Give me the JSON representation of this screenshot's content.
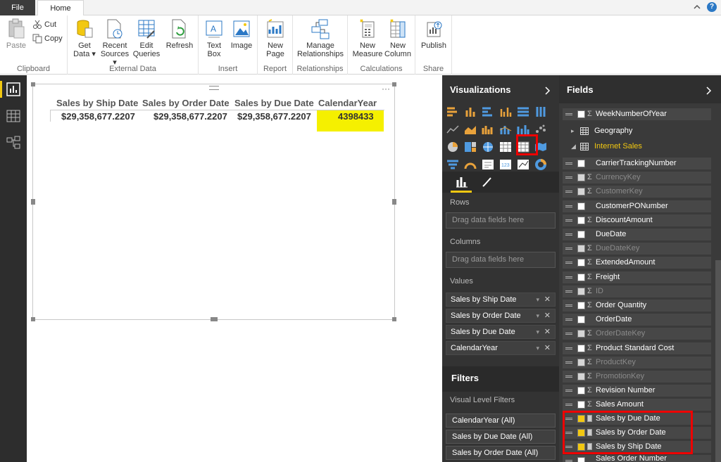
{
  "tabs": {
    "file": "File",
    "home": "Home"
  },
  "ribbon": {
    "clipboard": {
      "label": "Clipboard",
      "paste": "Paste",
      "cut": "Cut",
      "copy": "Copy"
    },
    "external_data": {
      "label": "External Data",
      "get_data": [
        "Get",
        "Data ▾"
      ],
      "recent_sources": [
        "Recent",
        "Sources ▾"
      ],
      "edit_queries": [
        "Edit",
        "Queries"
      ],
      "refresh": "Refresh"
    },
    "insert": {
      "label": "Insert",
      "text_box": [
        "Text",
        "Box"
      ],
      "image": "Image"
    },
    "report": {
      "label": "Report",
      "new_page": [
        "New",
        "Page"
      ]
    },
    "relationships": {
      "label": "Relationships",
      "manage": [
        "Manage",
        "Relationships"
      ]
    },
    "calculations": {
      "label": "Calculations",
      "new_measure": [
        "New",
        "Measure"
      ],
      "new_column": [
        "New",
        "Column"
      ]
    },
    "share": {
      "label": "Share",
      "publish": "Publish"
    },
    "help": "?"
  },
  "table_visual": {
    "columns": [
      "Sales by Ship Date",
      "Sales by Order Date",
      "Sales by Due Date",
      "CalendarYear"
    ],
    "row": [
      "$29,358,677.2207",
      "$29,358,677.2207",
      "$29,358,677.2207",
      "4398433"
    ],
    "more": "···"
  },
  "visualizations": {
    "title": "Visualizations",
    "rows_label": "Rows",
    "rows_placeholder": "Drag data fields here",
    "columns_label": "Columns",
    "columns_placeholder": "Drag data fields here",
    "values_label": "Values",
    "values": [
      "Sales by Ship Date",
      "Sales by Order Date",
      "Sales by Due Date",
      "CalendarYear"
    ]
  },
  "filters": {
    "title": "Filters",
    "visual_level": "Visual Level Filters",
    "items": [
      "CalendarYear (All)",
      "Sales by Due Date (All)",
      "Sales by Order Date (All)"
    ]
  },
  "fields": {
    "title": "Fields",
    "top_field": "WeekNumberOfYear",
    "tables": [
      "Geography",
      "Internet Sales"
    ],
    "items": [
      {
        "name": "CarrierTrackingNumber",
        "sigma": false,
        "dim": false,
        "checked": false
      },
      {
        "name": "CurrencyKey",
        "sigma": true,
        "dim": true,
        "checked": false
      },
      {
        "name": "CustomerKey",
        "sigma": true,
        "dim": true,
        "checked": false
      },
      {
        "name": "CustomerPONumber",
        "sigma": false,
        "dim": false,
        "checked": false
      },
      {
        "name": "DiscountAmount",
        "sigma": true,
        "dim": false,
        "checked": false
      },
      {
        "name": "DueDate",
        "sigma": false,
        "dim": false,
        "checked": false
      },
      {
        "name": "DueDateKey",
        "sigma": true,
        "dim": true,
        "checked": false
      },
      {
        "name": "ExtendedAmount",
        "sigma": true,
        "dim": false,
        "checked": false
      },
      {
        "name": "Freight",
        "sigma": true,
        "dim": false,
        "checked": false
      },
      {
        "name": "ID",
        "sigma": true,
        "dim": true,
        "checked": false
      },
      {
        "name": "Order Quantity",
        "sigma": true,
        "dim": false,
        "checked": false
      },
      {
        "name": "OrderDate",
        "sigma": false,
        "dim": false,
        "checked": false
      },
      {
        "name": "OrderDateKey",
        "sigma": true,
        "dim": true,
        "checked": false
      },
      {
        "name": "Product Standard Cost",
        "sigma": true,
        "dim": false,
        "checked": false
      },
      {
        "name": "ProductKey",
        "sigma": true,
        "dim": true,
        "checked": false
      },
      {
        "name": "PromotionKey",
        "sigma": true,
        "dim": true,
        "checked": false
      },
      {
        "name": "Revision Number",
        "sigma": true,
        "dim": false,
        "checked": false
      },
      {
        "name": "Sales Amount",
        "sigma": true,
        "dim": false,
        "checked": false
      }
    ],
    "measures": [
      "Sales by Due Date",
      "Sales by Order Date",
      "Sales by Ship Date"
    ],
    "last_item": "Sales Order Number"
  },
  "colors": {
    "highlight": "#f5f000",
    "check": "#f2c811",
    "annotation": "#e00000",
    "internet_sales": "#f2c811"
  }
}
